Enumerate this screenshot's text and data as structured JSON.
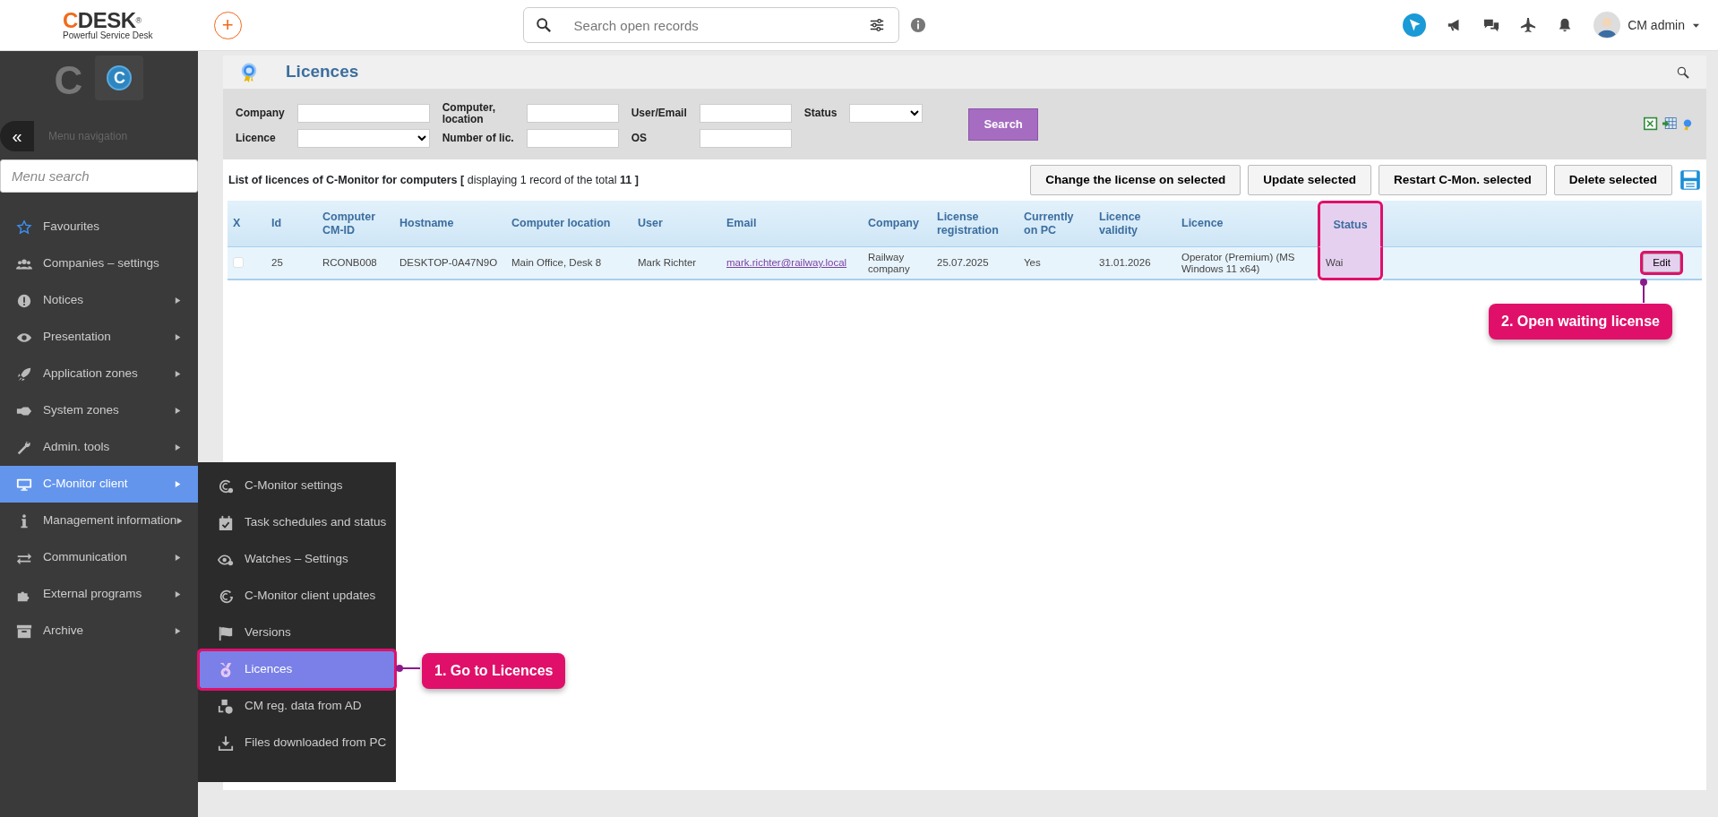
{
  "header": {
    "logo": {
      "letter": "C",
      "name": "DESK",
      "mark": "®",
      "tagline": "Powerful Service Desk"
    },
    "add_button": "+",
    "search": {
      "placeholder": "Search open records"
    },
    "user": {
      "name": "CM admin"
    }
  },
  "sidebar": {
    "logos": [
      "C",
      "C"
    ],
    "collapse": "«",
    "nav_label": "Menu navigation",
    "search": {
      "placeholder": "Menu search"
    },
    "items": [
      {
        "label": "Favourites",
        "has_submenu": false,
        "selected": false
      },
      {
        "label": "Companies – settings",
        "has_submenu": false,
        "selected": false
      },
      {
        "label": "Notices",
        "has_submenu": true,
        "selected": false
      },
      {
        "label": "Presentation",
        "has_submenu": true,
        "selected": false
      },
      {
        "label": "Application zones",
        "has_submenu": true,
        "selected": false
      },
      {
        "label": "System zones",
        "has_submenu": true,
        "selected": false
      },
      {
        "label": "Admin. tools",
        "has_submenu": true,
        "selected": false
      },
      {
        "label": "C-Monitor client",
        "has_submenu": true,
        "selected": true
      },
      {
        "label": "Management information",
        "has_submenu": true,
        "selected": false
      },
      {
        "label": "Communication",
        "has_submenu": true,
        "selected": false
      },
      {
        "label": "External programs",
        "has_submenu": true,
        "selected": false
      },
      {
        "label": "Archive",
        "has_submenu": true,
        "selected": false
      }
    ]
  },
  "submenu": {
    "items": [
      {
        "label": "C-Monitor settings",
        "selected": false
      },
      {
        "label": "Task schedules and status",
        "selected": false
      },
      {
        "label": "Watches – Settings",
        "selected": false
      },
      {
        "label": "C-Monitor client updates",
        "selected": false
      },
      {
        "label": "Versions",
        "selected": false
      },
      {
        "label": "Licences",
        "selected": true
      },
      {
        "label": "CM reg. data from AD",
        "selected": false
      },
      {
        "label": "Files downloaded from PC",
        "selected": false
      }
    ]
  },
  "page": {
    "title": "Licences",
    "filter_rows": [
      [
        {
          "label": "Company",
          "kind": "text"
        },
        {
          "label": "Computer, location",
          "kind": "text"
        },
        {
          "label": "User/Email",
          "kind": "text"
        },
        {
          "label": "Status",
          "kind": "select"
        }
      ],
      [
        {
          "label": "Licence",
          "kind": "select"
        },
        {
          "label": "Number of lic.",
          "kind": "text"
        },
        {
          "label": "OS",
          "kind": "text"
        }
      ]
    ],
    "search_button": "Search",
    "list_caption": "List of licences of C-Monitor for computers **[** displaying 1 record of the total **11** **]**",
    "actions": [
      "Change the license on selected",
      "Update selected",
      "Restart C-Mon. selected",
      "Delete selected"
    ],
    "table": {
      "columns": [
        {
          "label": "X",
          "highlighted": false
        },
        {
          "label": "Id",
          "highlighted": false
        },
        {
          "label": "Computer CM-ID",
          "highlighted": false
        },
        {
          "label": "Hostname",
          "highlighted": false
        },
        {
          "label": "Computer location",
          "highlighted": false
        },
        {
          "label": "User",
          "highlighted": false
        },
        {
          "label": "Email",
          "highlighted": false
        },
        {
          "label": "Company",
          "highlighted": false
        },
        {
          "label": "License registration",
          "highlighted": false
        },
        {
          "label": "Currently on PC",
          "highlighted": false
        },
        {
          "label": "Licence validity",
          "highlighted": false
        },
        {
          "label": "Licence",
          "highlighted": false
        },
        {
          "label": "Status",
          "highlighted": true
        }
      ],
      "rows": [
        {
          "checked": false,
          "cells": [
            "",
            "25",
            "RCONB008",
            "DESKTOP-0A47N9O",
            "Main Office, Desk 8",
            "Mark Richter",
            "mark.richter@railway.local",
            "Railway company",
            "25.07.2025",
            "Yes",
            "31.01.2026",
            "Operator (Premium) (MS Windows 11 x64)",
            "Wai"
          ],
          "action": "Edit",
          "action_highlighted": true
        }
      ]
    }
  },
  "callouts": [
    {
      "text": "1. Go to Licences"
    },
    {
      "text": "2. Open waiting license"
    }
  ]
}
